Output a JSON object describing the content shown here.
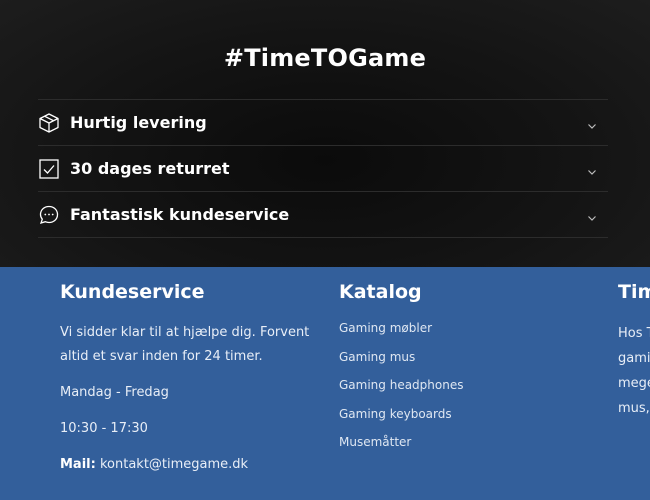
{
  "hero": {
    "headline": "#TimeTOGame",
    "items": [
      {
        "label": "Hurtig levering",
        "icon": "box-icon"
      },
      {
        "label": "30 dages returret",
        "icon": "checkbox-icon"
      },
      {
        "label": "Fantastisk kundeservice",
        "icon": "chat-bubble-icon"
      }
    ]
  },
  "footer": {
    "service": {
      "title": "Kundeservice",
      "text": "Vi sidder klar til at hjælpe dig. Forvent altid et svar inden for 24 timer.",
      "days": "Mandag - Fredag",
      "hours": "10:30 - 17:30",
      "mail_label": "Mail:",
      "mail": "kontakt@timegame.dk"
    },
    "catalog": {
      "title": "Katalog",
      "links": [
        "Gaming møbler",
        "Gaming mus",
        "Gaming headphones",
        "Gaming keyboards",
        "Musemåtter"
      ]
    },
    "about": {
      "title": "Tim",
      "lines": [
        "Hos T",
        "gami",
        "mege",
        "mus,"
      ]
    }
  },
  "colors": {
    "dark_bg": "#141414",
    "footer_bg": "#335f9b",
    "text": "#ffffff"
  }
}
